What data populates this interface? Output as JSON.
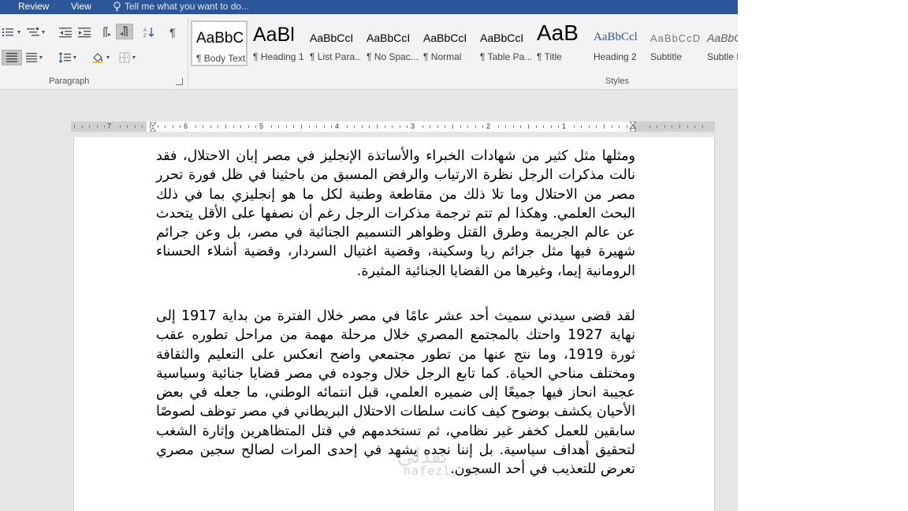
{
  "tabs": {
    "review": "Review",
    "view": "View",
    "tell_me": "Tell me what you want to do..."
  },
  "ribbon": {
    "paragraph_label": "Paragraph",
    "styles_label": "Styles",
    "styles": [
      {
        "preview": "AaBbC",
        "name": "¶ Body Text",
        "selected": true
      },
      {
        "preview": "AaBl",
        "name": "¶ Heading 1"
      },
      {
        "preview": "AaBbCcI",
        "name": "¶ List Para..."
      },
      {
        "preview": "AaBbCcI",
        "name": "¶ No Spac..."
      },
      {
        "preview": "AaBbCcI",
        "name": "¶ Normal"
      },
      {
        "preview": "AaBbCcI",
        "name": "¶ Table Pa..."
      },
      {
        "preview": "AaB",
        "name": "¶ Title"
      },
      {
        "preview": "AaBbCcl",
        "name": "Heading 2"
      },
      {
        "preview": "AaBbCcD",
        "name": "Subtitle"
      },
      {
        "preview": "AaBbCcI",
        "name": "Subtle E"
      }
    ]
  },
  "ruler": {
    "numbers": [
      "7",
      "6",
      "5",
      "4",
      "3",
      "2",
      "1"
    ]
  },
  "document": {
    "paragraph1": "ومثلها مثل كثير من شهادات الخبراء والأساتذة الإنجليز في مصر إبان الاحتلال، فقد نالت مذكرات الرجل نظرة الارتياب والرفض المسبق من باحثينا في ظل فورة تحرر مصر من الاحتلال وما تلا ذلك من مقاطعة وطنية لكل ما هو إنجليزي بما في ذلك البحث العلمي. وهكذا لم تتم ترجمة مذكرات الرجل رغم أن نصفها على الأقل يتحدث عن عالم الجريمة وطرق القتل وظواهر التسميم الجنائية في مصر، بل وعن جرائم شهيرة فيها مثل جرائم ريا وسكينة، وقضية اغتيال السردار، وقضية أشلاء الحسناء الرومانية إيما، وغيرها من القضايا الجنائية المثيرة.",
    "paragraph2": "لقد قضى سيدني سميث أحد عشر عامًا في مصر خلال الفترة من بداية 1917 إلى نهاية 1927 واحتك بالمجتمع المصري خلال مرحلة مهمة من مراحل تطوره عقب ثورة 1919، وما نتج عنها من تطور مجتمعي واضح انعكس على التعليم والثقافة ومختلف مناحي الحياة. كما تابع الرجل خلال وجوده في مصر قضايا جنائية وسياسية عجيبة انحاز فيها جميعًا إلى ضميره العلمي، قبل انتمائه الوطني، ما جعله في بعض الأحيان يكشف بوضوح كيف كانت سلطات الاحتلال البريطاني في مصر توظف لصوصًا سابقين للعمل كخفر غير نظامي، ثم تستخدمهم في قتل المتظاهرين وإثارة الشغب لتحقيق أهداف سياسية. بل إننا نجده يشهد في إحدى المرات لصالح سجين مصري تعرض للتعذيب في أحد السجون."
  },
  "watermark": {
    "arabic": "نفذلي",
    "latin": "nafezly.com"
  },
  "colors": {
    "titlebar": "#2b579a",
    "ribbon_bg": "#f3f3f3",
    "doc_bg": "#e6e6e6"
  }
}
